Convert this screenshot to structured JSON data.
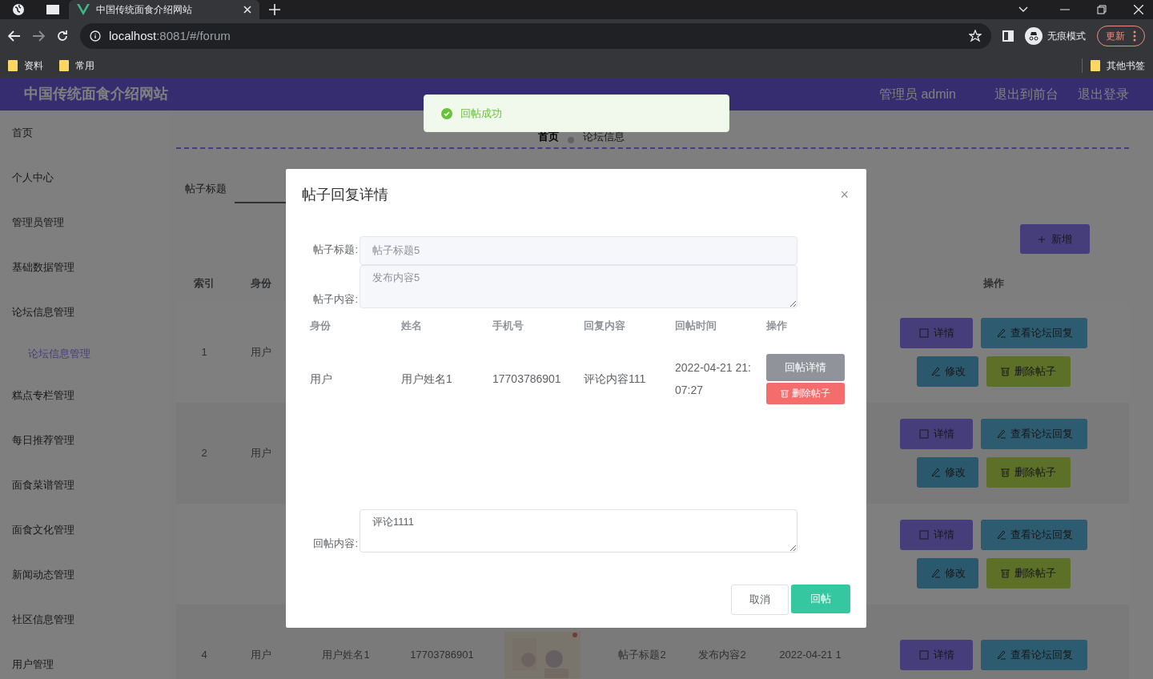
{
  "browser": {
    "tabs": [
      {
        "title": "中国传统面食介绍网站",
        "selected": true
      }
    ],
    "url_host": "localhost",
    "url_rest": ":8081/#/forum",
    "incognito": "无痕模式",
    "update_button": "更新",
    "bookmarks": [
      "资料",
      "常用"
    ],
    "other_bookmarks": "其他书签"
  },
  "header": {
    "title": "中国传统面食介绍网站",
    "user": "管理员 admin",
    "links": [
      "退出到前台",
      "退出登录"
    ]
  },
  "sidebar": {
    "items": [
      {
        "label": "首页",
        "selected": false
      },
      {
        "label": "个人中心",
        "selected": false
      },
      {
        "label": "管理员管理",
        "selected": false
      },
      {
        "label": "基础数据管理",
        "selected": false
      },
      {
        "label": "论坛信息管理",
        "selected": false,
        "children": [
          {
            "label": "论坛信息管理",
            "selected": true
          }
        ]
      },
      {
        "label": "糕点专栏管理",
        "selected": false
      },
      {
        "label": "每日推荐管理",
        "selected": false
      },
      {
        "label": "面食菜谱管理",
        "selected": false
      },
      {
        "label": "面食文化管理",
        "selected": false
      },
      {
        "label": "新闻动态管理",
        "selected": false
      },
      {
        "label": "社区信息管理",
        "selected": false
      },
      {
        "label": "用户管理",
        "selected": false
      }
    ]
  },
  "breadcrumb": [
    "首页",
    "论坛信息"
  ],
  "search": {
    "label": "帖子标题"
  },
  "add_button": "新增",
  "table": {
    "columns": [
      {
        "kind": "index",
        "label": "索引"
      },
      {
        "kind": "identity",
        "label": "身份"
      },
      {
        "kind": "actions",
        "label": "操作"
      }
    ],
    "rows": [
      {
        "index": "1",
        "identity": "用户",
        "actions": [
          {
            "kind": "detail",
            "label": "详情"
          },
          {
            "kind": "replies",
            "label": "查看论坛回复"
          },
          {
            "kind": "edit",
            "label": "修改"
          },
          {
            "kind": "delete",
            "label": "删除帖子"
          }
        ]
      },
      {
        "index": "2",
        "identity": "用户",
        "actions": [
          {
            "kind": "detail",
            "label": "详情"
          },
          {
            "kind": "replies",
            "label": "查看论坛回复"
          },
          {
            "kind": "edit",
            "label": "修改"
          },
          {
            "kind": "delete",
            "label": "删除帖子"
          }
        ]
      },
      {
        "actions": [
          {
            "kind": "detail",
            "label": "详情"
          },
          {
            "kind": "replies",
            "label": "查看论坛回复"
          },
          {
            "kind": "edit",
            "label": "修改"
          },
          {
            "kind": "delete",
            "label": "删除帖子"
          }
        ]
      },
      {
        "index": "4",
        "identity": "用户",
        "name": "用户姓名1",
        "phone": "17703786901",
        "image": {
          "kind": "picture"
        },
        "title": "帖子标题2",
        "content": "发布内容2",
        "time": "2022-04-21 1",
        "actions": [
          {
            "kind": "detail",
            "label": "详情"
          },
          {
            "kind": "replies",
            "label": "查看论坛回复"
          }
        ]
      }
    ]
  },
  "toast": {
    "kind": "success",
    "message": "回帖成功"
  },
  "dialog": {
    "title": "帖子回复详情",
    "close": "×",
    "fields": [
      {
        "label": "帖子标题:",
        "value": "帖子标题5",
        "kind": "input",
        "disabled": true
      },
      {
        "label": "帖子内容:",
        "value": "发布内容5",
        "kind": "textarea",
        "disabled": true
      }
    ],
    "reply_table": {
      "columns": [
        "身份",
        "姓名",
        "手机号",
        "回复内容",
        "回帖时间",
        "操作"
      ],
      "rows": [
        {
          "cells": [
            "用户",
            "用户姓名1",
            "17703786901",
            "评论内容111",
            "2022-04-21 21:07:27"
          ],
          "actions": [
            {
              "kind": "detail",
              "label": "回帖详情"
            },
            {
              "kind": "delete",
              "label": "删除帖子"
            }
          ]
        }
      ]
    },
    "reply_field": {
      "label": "回帖内容:",
      "value": "评论1111",
      "kind": "textarea",
      "disabled": false
    },
    "buttons": [
      {
        "kind": "cancel",
        "label": "取消"
      },
      {
        "kind": "primary",
        "label": "回帖"
      }
    ]
  }
}
